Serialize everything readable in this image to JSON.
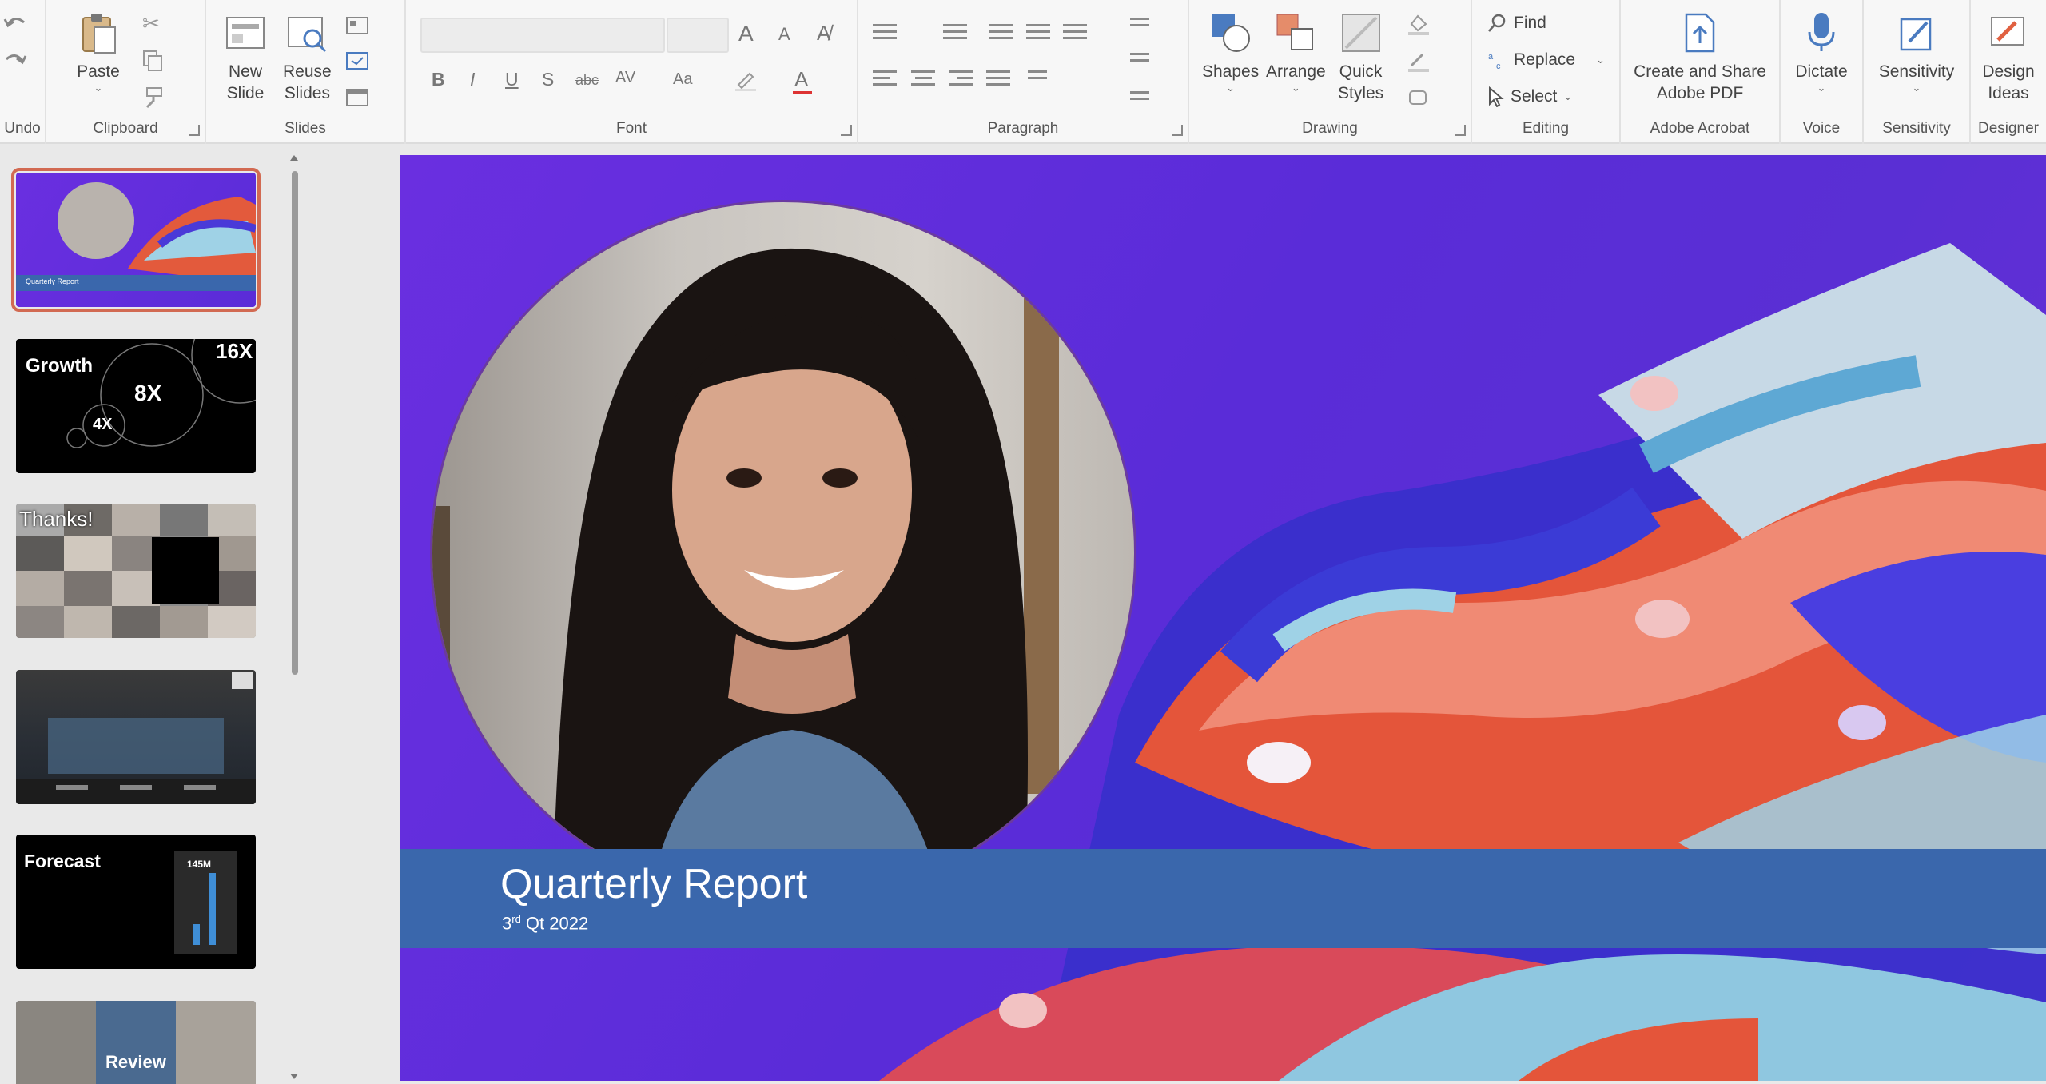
{
  "ribbon": {
    "undo": {
      "label": "Undo"
    },
    "clipboard": {
      "group": "Clipboard",
      "paste": "Paste"
    },
    "slides": {
      "group": "Slides",
      "new_slide_line1": "New",
      "new_slide_line2": "Slide",
      "reuse_line1": "Reuse",
      "reuse_line2": "Slides"
    },
    "font": {
      "group": "Font",
      "bold": "B",
      "italic": "I",
      "underline": "U",
      "strike": "S",
      "abc": "abc",
      "spacing": "AV",
      "case": "Aa",
      "grow": "A",
      "shrink": "A"
    },
    "paragraph": {
      "group": "Paragraph"
    },
    "drawing": {
      "group": "Drawing",
      "shapes": "Shapes",
      "arrange": "Arrange",
      "quick_line1": "Quick",
      "quick_line2": "Styles"
    },
    "editing": {
      "group": "Editing",
      "find": "Find",
      "replace": "Replace",
      "select": "Select"
    },
    "acrobat": {
      "group": "Adobe Acrobat",
      "line1": "Create and Share",
      "line2": "Adobe PDF"
    },
    "voice": {
      "group": "Voice",
      "dictate": "Dictate"
    },
    "sensitivity": {
      "group": "Sensitivity",
      "label": "Sensitivity"
    },
    "designer": {
      "group": "Designer",
      "line1": "Design",
      "line2": "Ideas"
    }
  },
  "thumbnails": [
    {
      "title": "Quarterly Report",
      "selected": true
    },
    {
      "title": "Growth",
      "numbers": [
        "16X",
        "8X",
        "4X"
      ]
    },
    {
      "title": "Thanks!"
    },
    {
      "title": ""
    },
    {
      "title": "Forecast",
      "value": "145M"
    },
    {
      "title": "Review"
    }
  ],
  "slide": {
    "title": "Quarterly Report",
    "subtitle_num": "3",
    "subtitle_sup": "rd",
    "subtitle_rest": " Qt 2022"
  },
  "colors": {
    "slide_bg": "#5a2cd8",
    "title_band": "#3a67ac",
    "selection": "#d26a52"
  }
}
